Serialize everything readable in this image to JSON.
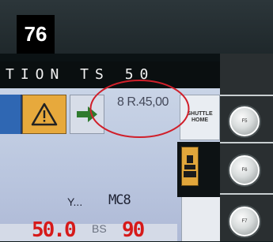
{
  "header": {
    "page_number": "76"
  },
  "screen": {
    "title": "TION TS 50",
    "price": "8 R.45,00",
    "shuttle_home": {
      "line1": "SHUTTLE",
      "line2": "HOME"
    },
    "y_label": "Y...",
    "mode": "MC8",
    "value_left": "50.0",
    "bs_label": "BS",
    "value_right": "90"
  },
  "hardware_buttons": [
    "F5",
    "F6",
    "F7"
  ],
  "colors": {
    "warning": "#e7a93c",
    "highlight": "#d01f2a",
    "readout_red": "#d61a1a"
  },
  "icons": [
    "warning-triangle-icon",
    "arrow-right-icon",
    "machine-icon"
  ]
}
